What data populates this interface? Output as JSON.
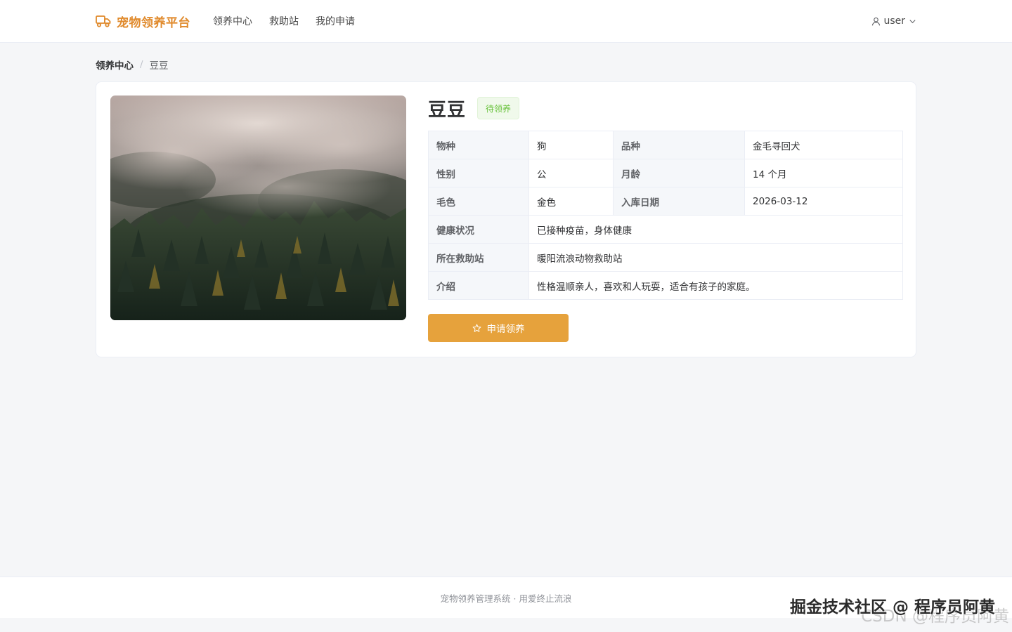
{
  "header": {
    "brand": "宠物领养平台",
    "nav": [
      {
        "label": "领养中心"
      },
      {
        "label": "救助站"
      },
      {
        "label": "我的申请"
      }
    ],
    "user": "user"
  },
  "breadcrumb": {
    "parent": "领养中心",
    "separator": "/",
    "current": "豆豆"
  },
  "pet": {
    "name": "豆豆",
    "status": "待领养",
    "info": {
      "species_label": "物种",
      "species": "狗",
      "breed_label": "品种",
      "breed": "金毛寻回犬",
      "gender_label": "性别",
      "gender": "公",
      "age_label": "月龄",
      "age": "14 个月",
      "color_label": "毛色",
      "color": "金色",
      "intake_label": "入库日期",
      "intake": "2026-03-12",
      "health_label": "健康状况",
      "health": "已接种疫苗，身体健康",
      "station_label": "所在救助站",
      "station": "暖阳流浪动物救助站",
      "intro_label": "介绍",
      "intro": "性格温顺亲人，喜欢和人玩耍，适合有孩子的家庭。"
    },
    "apply_label": "申请领养"
  },
  "footer": {
    "text": "宠物领养管理系统 · 用爱终止流浪"
  },
  "watermark": {
    "front": "掘金技术社区 @ 程序员阿黄",
    "back": "CSDN @程序员阿黄"
  },
  "colors": {
    "brand": "#e08a2c",
    "button": "#e6a23c",
    "tag_text": "#67c23a",
    "tag_bg": "#f0f9eb",
    "page_bg": "#f5f6f8"
  }
}
